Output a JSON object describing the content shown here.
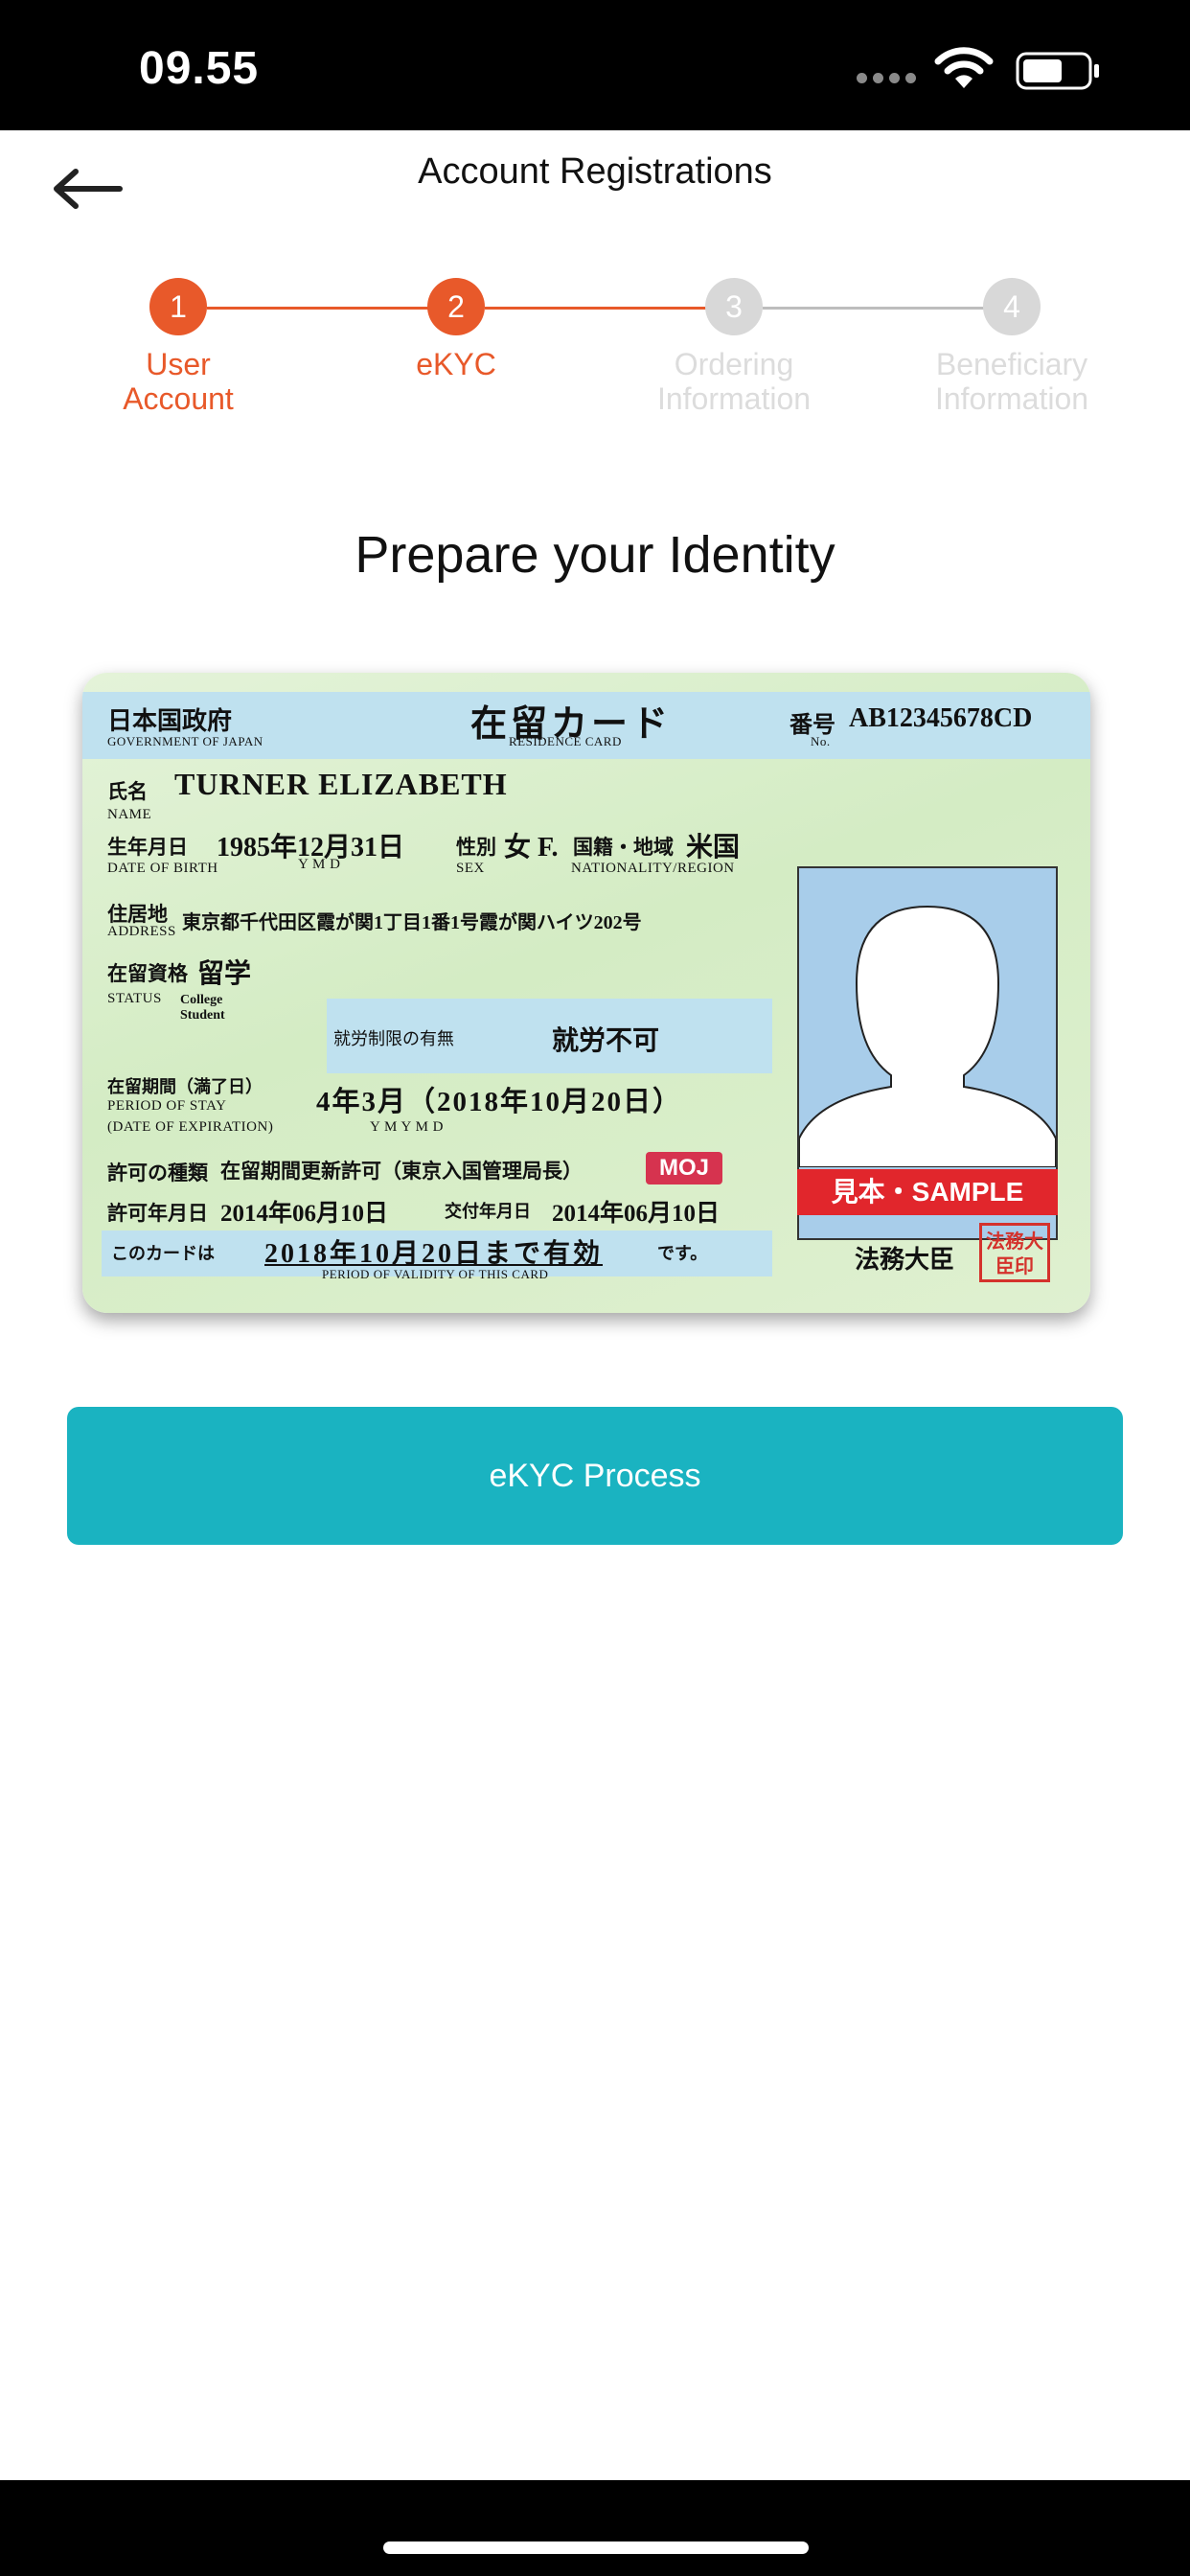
{
  "status_bar": {
    "time": "09.55",
    "icons": [
      "signal-icon",
      "wifi-icon",
      "battery-icon"
    ]
  },
  "header": {
    "title": "Account Registrations",
    "back_icon": "arrow-left-icon"
  },
  "stepper": {
    "steps": [
      {
        "number": "1",
        "label_line1": "User",
        "label_line2": "Account",
        "state": "complete"
      },
      {
        "number": "2",
        "label_line1": "eKYC",
        "label_line2": "",
        "state": "active"
      },
      {
        "number": "3",
        "label_line1": "Ordering",
        "label_line2": "Information",
        "state": "inactive"
      },
      {
        "number": "4",
        "label_line1": "Beneficiary",
        "label_line2": "Information",
        "state": "inactive"
      }
    ],
    "colors": {
      "active": "#e8592a",
      "inactive": "#d8d8d8"
    }
  },
  "main": {
    "title": "Prepare your Identity",
    "button_label": "eKYC Process",
    "button_color": "#1ab3c1"
  },
  "id_card": {
    "gov_jp": "日本国政府",
    "gov_en": "GOVERNMENT OF JAPAN",
    "card_title_jp": "在留カード",
    "card_title_en": "RESIDENCE CARD",
    "number_label": "番号",
    "number_en": "No.",
    "number": "AB12345678CD",
    "name_label_jp": "氏名",
    "name_label_en": "NAME",
    "name": "TURNER ELIZABETH",
    "dob_label_jp": "生年月日",
    "dob_label_en": "DATE OF BIRTH",
    "dob": "1985年12月31日",
    "dob_ymd": "Y      M      D",
    "sex_label_jp": "性別",
    "sex_label_en": "SEX",
    "sex": "女 F.",
    "nationality_label_jp": "国籍・地域",
    "nationality_label_en": "NATIONALITY/REGION",
    "nationality": "米国",
    "address_label_jp": "住居地",
    "address_label_en": "ADDRESS",
    "address": "東京都千代田区霞が関1丁目1番1号霞が関ハイツ202号",
    "status_label_jp": "在留資格",
    "status_label_en": "STATUS",
    "status": "留学",
    "status_en": "College Student",
    "work_label": "就労制限の有無",
    "work_value": "就労不可",
    "period_label_jp": "在留期間（満了日）",
    "period_label_en": "PERIOD OF STAY",
    "expiry_label_en": "(DATE OF EXPIRATION)",
    "period": "4年3月（2018年10月20日）",
    "period_ymd": "Y      M                  Y       M       D",
    "permit_label": "許可の種類",
    "permit": "在留期間更新許可（東京入国管理局長）",
    "moj": "MOJ",
    "permit_date_label": "許可年月日",
    "permit_date": "2014年06月10日",
    "issue_date_label": "交付年月日",
    "issue_date": "2014年06月10日",
    "validity_prefix": "このカードは",
    "validity": "2018年10月20日まで有効",
    "validity_suffix": "です。",
    "validity_en": "PERIOD OF VALIDITY OF THIS CARD",
    "minister": "法務大臣",
    "seal_text": "法務大臣印",
    "sample": "見本・SAMPLE"
  }
}
